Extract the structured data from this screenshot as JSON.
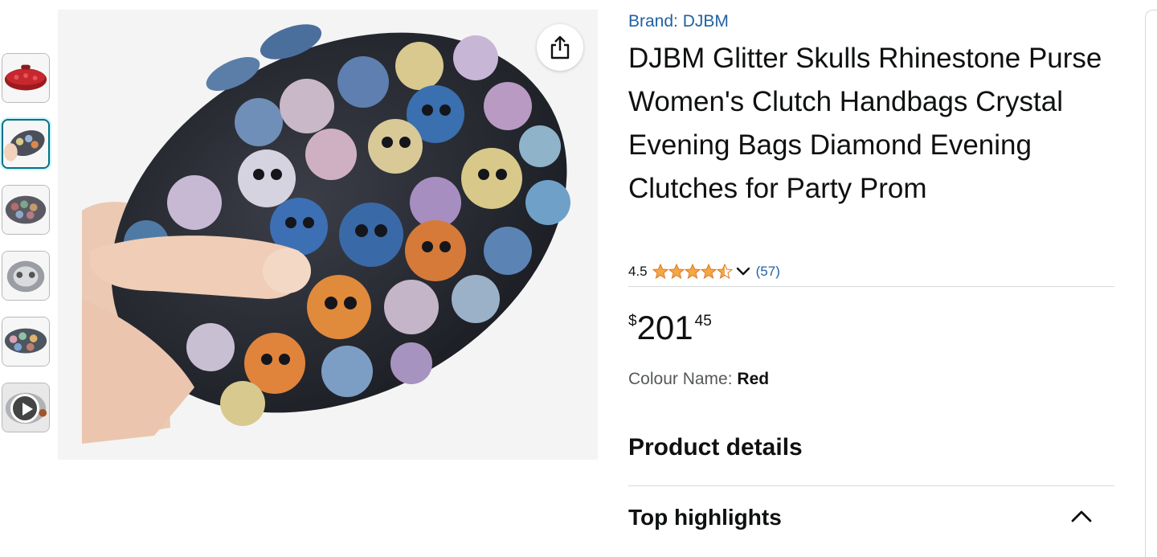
{
  "product": {
    "brand_label": "Brand: DJBM",
    "title": "DJBM Glitter Skulls Rhinestone Purse Women's Clutch Handbags Crystal Evening Bags Diamond Evening Clutches for Party Prom",
    "rating": {
      "value": "4.5",
      "stars": 4.5,
      "max_stars": 5,
      "star_color": "#f3a847",
      "review_count": "(57)"
    },
    "price": {
      "symbol": "$",
      "whole": "201",
      "fraction": "45"
    },
    "colour": {
      "label": "Colour Name:",
      "value": "Red"
    }
  },
  "gallery": {
    "thumbnails": [
      {
        "name": "red-crystal-clutch",
        "selected": false
      },
      {
        "name": "skull-clutch-in-hand",
        "selected": true
      },
      {
        "name": "skull-clutch-front",
        "selected": false
      },
      {
        "name": "clutch-open-interior",
        "selected": false
      },
      {
        "name": "skull-clutch-side",
        "selected": false
      },
      {
        "name": "product-video",
        "selected": false,
        "is_video": true
      }
    ],
    "share_icon": "share-icon"
  },
  "sections": {
    "product_details_title": "Product details",
    "top_highlights_label": "Top highlights",
    "top_highlights_expanded": true
  },
  "colors": {
    "link": "#2162a1",
    "text": "#0f1111",
    "secondary_text": "#565959",
    "selected_thumb_border": "#007185",
    "star": "#f3a847"
  }
}
